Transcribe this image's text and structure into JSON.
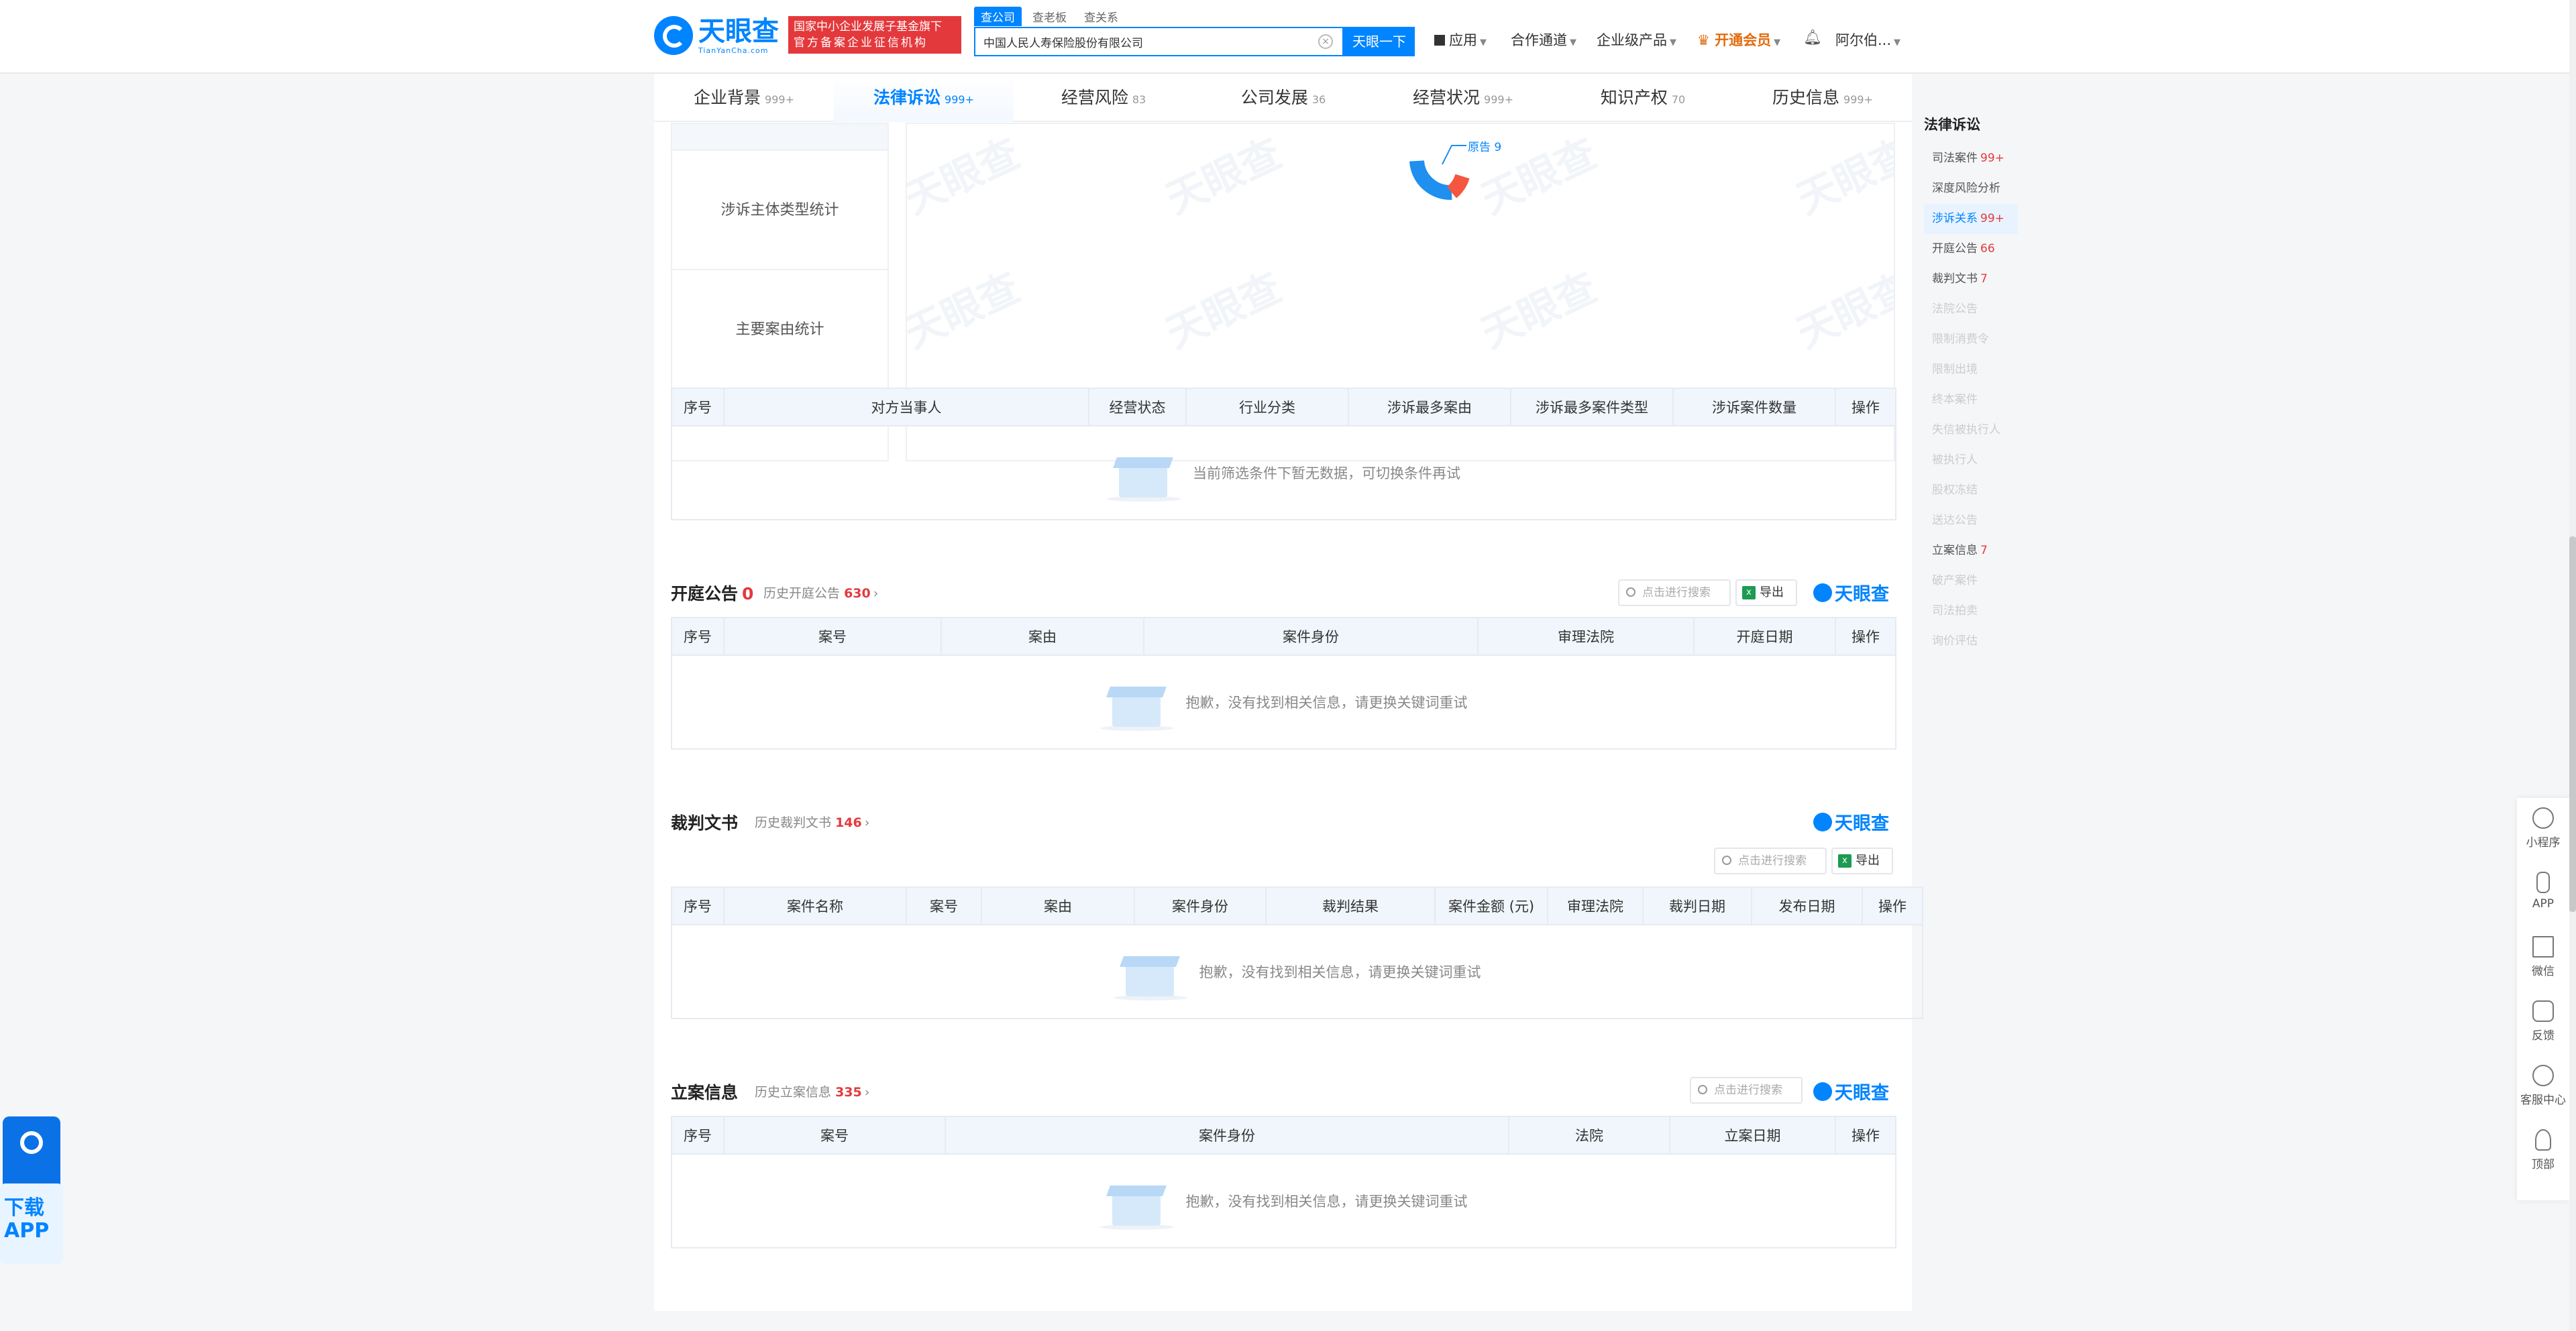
{
  "header": {
    "logo_cn": "天眼查",
    "logo_en": "TianYanCha.com",
    "gov_badge_line1": "国家中小企业发展子基金旗下",
    "gov_badge_line2": "官方备案企业征信机构",
    "search_tabs": [
      "查公司",
      "查老板",
      "查关系"
    ],
    "search_value": "中国人民人寿保险股份有限公司",
    "search_button": "天眼一下",
    "nav": [
      "应用",
      "合作通道",
      "企业级产品",
      "开通会员",
      "阿尔伯..."
    ]
  },
  "tabs": [
    {
      "label": "企业背景",
      "count": "999+"
    },
    {
      "label": "法律诉讼",
      "count": "999+"
    },
    {
      "label": "经营风险",
      "count": "83"
    },
    {
      "label": "公司发展",
      "count": "36"
    },
    {
      "label": "经营状况",
      "count": "999+"
    },
    {
      "label": "知识产权",
      "count": "70"
    },
    {
      "label": "历史信息",
      "count": "999+"
    }
  ],
  "relations": {
    "stats": [
      "涉诉主体类型统计",
      "主要案由统计"
    ],
    "donut_label": "原告 9",
    "columns": [
      "序号",
      "对方当事人",
      "经营状态",
      "行业分类",
      "涉诉最多案由",
      "涉诉最多案件类型",
      "涉诉案件数量",
      "操作"
    ],
    "empty_text": "当前筛选条件下暂无数据，可切换条件再试"
  },
  "court_notice": {
    "title": "开庭公告",
    "count": "0",
    "history_label": "历史开庭公告",
    "history_count": "630",
    "search_placeholder": "点击进行搜索",
    "export_label": "导出",
    "columns": [
      "序号",
      "案号",
      "案由",
      "案件身份",
      "审理法院",
      "开庭日期",
      "操作"
    ],
    "empty_text": "抱歉，没有找到相关信息，请更换关键词重试"
  },
  "judgment": {
    "title": "裁判文书",
    "history_label": "历史裁判文书",
    "history_count": "146",
    "search_placeholder": "点击进行搜索",
    "export_label": "导出",
    "columns": [
      "序号",
      "案件名称",
      "案号",
      "案由",
      "案件身份",
      "裁判结果",
      "案件金额 (元)",
      "审理法院",
      "裁判日期",
      "发布日期",
      "操作"
    ],
    "empty_text": "抱歉，没有找到相关信息，请更换关键词重试"
  },
  "filing": {
    "title": "立案信息",
    "history_label": "历史立案信息",
    "history_count": "335",
    "search_placeholder": "点击进行搜索",
    "columns": [
      "序号",
      "案号",
      "案件身份",
      "法院",
      "立案日期",
      "操作"
    ],
    "empty_text": "抱歉，没有找到相关信息，请更换关键词重试"
  },
  "brand_mini": "天眼查",
  "watermark": "天眼查",
  "sidenav": {
    "title": "法律诉讼",
    "items": [
      {
        "label": "司法案件",
        "count": "99+",
        "state": "normal"
      },
      {
        "label": "深度风险分析",
        "count": "",
        "state": "normal"
      },
      {
        "label": "涉诉关系",
        "count": "99+",
        "state": "active"
      },
      {
        "label": "开庭公告",
        "count": "66",
        "state": "normal"
      },
      {
        "label": "裁判文书",
        "count": "7",
        "state": "normal"
      },
      {
        "label": "法院公告",
        "count": "",
        "state": "disabled"
      },
      {
        "label": "限制消费令",
        "count": "",
        "state": "disabled"
      },
      {
        "label": "限制出境",
        "count": "",
        "state": "disabled"
      },
      {
        "label": "终本案件",
        "count": "",
        "state": "disabled"
      },
      {
        "label": "失信被执行人",
        "count": "",
        "state": "disabled"
      },
      {
        "label": "被执行人",
        "count": "",
        "state": "disabled"
      },
      {
        "label": "股权冻结",
        "count": "",
        "state": "disabled"
      },
      {
        "label": "送达公告",
        "count": "",
        "state": "disabled"
      },
      {
        "label": "立案信息",
        "count": "7",
        "state": "normal"
      },
      {
        "label": "破产案件",
        "count": "",
        "state": "disabled"
      },
      {
        "label": "司法拍卖",
        "count": "",
        "state": "disabled"
      },
      {
        "label": "询价评估",
        "count": "",
        "state": "disabled"
      }
    ]
  },
  "toolbar": [
    "小程序",
    "APP",
    "微信",
    "反馈",
    "客服中心",
    "顶部"
  ],
  "app_promo": {
    "line1": "下载",
    "line2": "APP"
  },
  "colors": {
    "accent": "#0084ff",
    "danger": "#e4393c",
    "vip": "#e36a0c"
  }
}
